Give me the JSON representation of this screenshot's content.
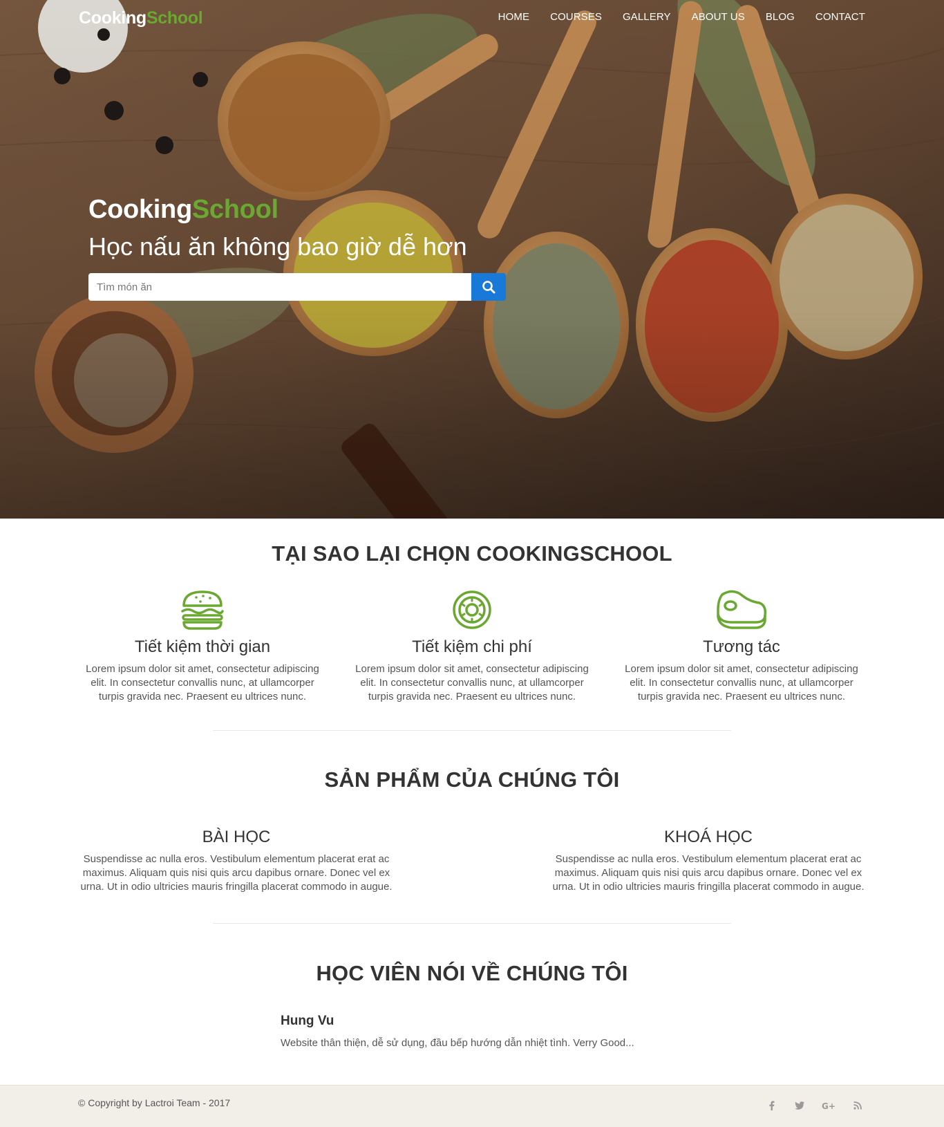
{
  "brand": {
    "part1": "Cooking",
    "part2": "School"
  },
  "nav": {
    "items": [
      "HOME",
      "COURSES",
      "GALLERY",
      "ABOUT US",
      "BLOG",
      "CONTACT"
    ]
  },
  "hero": {
    "brand_part1": "Cooking",
    "brand_part2": "School",
    "tagline": "Học nấu ăn không bao giờ dễ hơn",
    "search_placeholder": "Tìm món ăn"
  },
  "why": {
    "title": "TẠI SAO LẠI CHỌN COOKINGSCHOOL",
    "features": [
      {
        "icon": "burger-icon",
        "title": "Tiết kiệm thời gian",
        "text": "Lorem ipsum dolor sit amet, consectetur adipiscing elit. In consectetur convallis nunc, at ullamcorper turpis gravida nec. Praesent eu ultrices nunc."
      },
      {
        "icon": "donut-icon",
        "title": "Tiết kiệm chi phí",
        "text": "Lorem ipsum dolor sit amet, consectetur adipiscing elit. In consectetur convallis nunc, at ullamcorper turpis gravida nec. Praesent eu ultrices nunc."
      },
      {
        "icon": "steak-icon",
        "title": "Tương tác",
        "text": "Lorem ipsum dolor sit amet, consectetur adipiscing elit. In consectetur convallis nunc, at ullamcorper turpis gravida nec. Praesent eu ultrices nunc."
      }
    ]
  },
  "products": {
    "title": "SẢN PHẨM CỦA CHÚNG TÔI",
    "items": [
      {
        "title": "BÀI HỌC",
        "text": "Suspendisse ac nulla eros. Vestibulum elementum placerat erat ac maximus. Aliquam quis nisi quis arcu dapibus ornare. Donec vel ex urna. Ut in odio ultricies mauris fringilla placerat commodo in augue."
      },
      {
        "title": "KHOÁ HỌC",
        "text": "Suspendisse ac nulla eros. Vestibulum elementum placerat erat ac maximus. Aliquam quis nisi quis arcu dapibus ornare. Donec vel ex urna. Ut in odio ultricies mauris fringilla placerat commodo in augue."
      }
    ]
  },
  "testimonials": {
    "title": "HỌC VIÊN NÓI VỀ CHÚNG TÔI",
    "items": [
      {
        "name": "Hung Vu",
        "quote": "Website thân thiện, dễ sử dụng, đầu bếp hướng dẫn nhiệt tình. Verry Good..."
      }
    ]
  },
  "footer": {
    "copyright": "© Copyright by Lactroi Team - 2017",
    "social": [
      "facebook-icon",
      "twitter-icon",
      "google-plus-icon",
      "rss-icon"
    ]
  },
  "colors": {
    "accent_green": "#6aa832",
    "search_blue": "#1979d8",
    "footer_bg": "#f1efe8"
  }
}
